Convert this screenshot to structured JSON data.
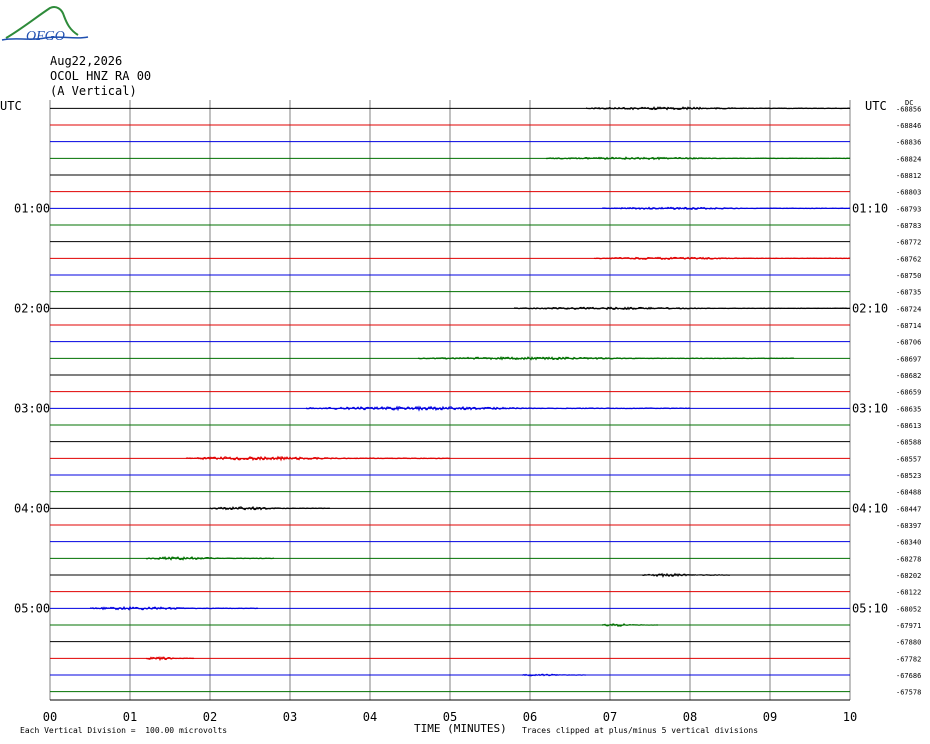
{
  "logo": {
    "text": "OFGO"
  },
  "header": {
    "date": "Aug22,2026",
    "channel": "OCOL HNZ RA 00",
    "component": "(A Vertical)"
  },
  "axis": {
    "left_timezone": "UTC",
    "right_timezone": "UTC",
    "x_title": "TIME (MINUTES)",
    "x_ticks": [
      "00",
      "01",
      "02",
      "03",
      "04",
      "05",
      "06",
      "07",
      "08",
      "09",
      "10"
    ],
    "left_hour_labels": [
      {
        "row": 6,
        "text": "01:00"
      },
      {
        "row": 12,
        "text": "02:00"
      },
      {
        "row": 18,
        "text": "03:00"
      },
      {
        "row": 24,
        "text": "04:00"
      },
      {
        "row": 30,
        "text": "05:00"
      }
    ],
    "right_hour_labels": [
      {
        "row": 6,
        "text": "01:10"
      },
      {
        "row": 12,
        "text": "02:10"
      },
      {
        "row": 18,
        "text": "03:10"
      },
      {
        "row": 24,
        "text": "04:10"
      },
      {
        "row": 30,
        "text": "05:10"
      }
    ],
    "right_top_label": "DC",
    "right_values": [
      "-68856",
      "-68846",
      "-68836",
      "-68824",
      "-68812",
      "-68803",
      "-68793",
      "-68783",
      "-68772",
      "-68762",
      "-68750",
      "-68735",
      "-68724",
      "-68714",
      "-68706",
      "-68697",
      "-68682",
      "-68659",
      "-68635",
      "-68613",
      "-68588",
      "-68557",
      "-68523",
      "-68488",
      "-68447",
      "-68397",
      "-68340",
      "-68278",
      "-68202",
      "-68122",
      "-68052",
      "-67971",
      "-67880",
      "-67782",
      "-67686",
      "-67578"
    ]
  },
  "footer": {
    "left": "Each Vertical Division =  100.00 microvolts",
    "right": "Traces clipped at plus/minus 5 vertical divisions"
  },
  "colors": {
    "trace_cycle": [
      "#000000",
      "#e00000",
      "#0000e0",
      "#007000"
    ],
    "grid": "#808080"
  },
  "chart_data": {
    "type": "line",
    "title": "",
    "xlabel": "TIME (MINUTES)",
    "ylabel": "",
    "xlim": [
      0,
      10
    ],
    "rows": 36,
    "row_minutes": 10,
    "series": [
      {
        "row": 0,
        "start": 6.7,
        "end": 10.0,
        "amp": 1.2
      },
      {
        "row": 1,
        "start": 0,
        "end": 0,
        "amp": 0
      },
      {
        "row": 2,
        "start": 0,
        "end": 0,
        "amp": 0
      },
      {
        "row": 3,
        "start": 6.2,
        "end": 10.0,
        "amp": 1.0
      },
      {
        "row": 4,
        "start": 0,
        "end": 0,
        "amp": 0
      },
      {
        "row": 5,
        "start": 0,
        "end": 0,
        "amp": 0
      },
      {
        "row": 6,
        "start": 6.9,
        "end": 10.0,
        "amp": 1.0
      },
      {
        "row": 7,
        "start": 0,
        "end": 0,
        "amp": 0
      },
      {
        "row": 8,
        "start": 0,
        "end": 0,
        "amp": 0
      },
      {
        "row": 9,
        "start": 6.8,
        "end": 10.0,
        "amp": 1.0
      },
      {
        "row": 10,
        "start": 0,
        "end": 0,
        "amp": 0
      },
      {
        "row": 11,
        "start": 0,
        "end": 0,
        "amp": 0
      },
      {
        "row": 12,
        "start": 5.8,
        "end": 10.0,
        "amp": 1.0
      },
      {
        "row": 13,
        "start": 0,
        "end": 0,
        "amp": 0
      },
      {
        "row": 14,
        "start": 0,
        "end": 0,
        "amp": 0
      },
      {
        "row": 15,
        "start": 4.6,
        "end": 9.3,
        "amp": 1.2
      },
      {
        "row": 16,
        "start": 0,
        "end": 0,
        "amp": 0
      },
      {
        "row": 17,
        "start": 0,
        "end": 0,
        "amp": 0
      },
      {
        "row": 18,
        "start": 3.2,
        "end": 8.0,
        "amp": 1.6
      },
      {
        "row": 19,
        "start": 0,
        "end": 0,
        "amp": 0
      },
      {
        "row": 20,
        "start": 0,
        "end": 0,
        "amp": 0
      },
      {
        "row": 21,
        "start": 1.7,
        "end": 5.0,
        "amp": 1.6
      },
      {
        "row": 22,
        "start": 0,
        "end": 0,
        "amp": 0
      },
      {
        "row": 23,
        "start": 0,
        "end": 0,
        "amp": 0
      },
      {
        "row": 24,
        "start": 2.0,
        "end": 3.5,
        "amp": 1.4
      },
      {
        "row": 25,
        "start": 0,
        "end": 0,
        "amp": 0
      },
      {
        "row": 26,
        "start": 0,
        "end": 0,
        "amp": 0
      },
      {
        "row": 27,
        "start": 1.2,
        "end": 2.8,
        "amp": 1.4
      },
      {
        "row": 28,
        "start": 7.4,
        "end": 8.5,
        "amp": 1.4
      },
      {
        "row": 29,
        "start": 0,
        "end": 0,
        "amp": 0
      },
      {
        "row": 30,
        "start": 0.5,
        "end": 2.6,
        "amp": 1.4
      },
      {
        "row": 31,
        "start": 6.9,
        "end": 7.6,
        "amp": 1.2
      },
      {
        "row": 32,
        "start": 0,
        "end": 0,
        "amp": 0
      },
      {
        "row": 33,
        "start": 1.2,
        "end": 1.8,
        "amp": 1.4
      },
      {
        "row": 34,
        "start": 5.9,
        "end": 6.7,
        "amp": 1.0
      },
      {
        "row": 35,
        "start": 0,
        "end": 0,
        "amp": 0
      }
    ]
  }
}
